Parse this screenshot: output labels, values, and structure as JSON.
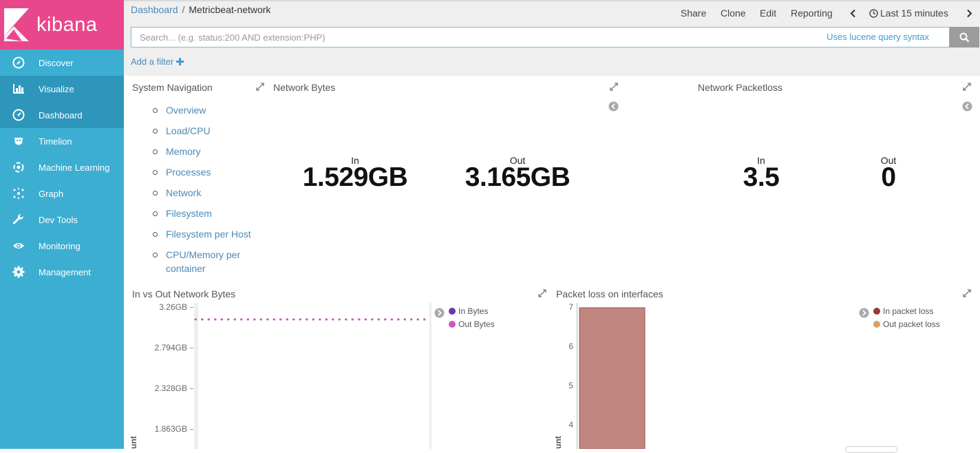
{
  "brand": {
    "name": "kibana",
    "logo_color": "#e8488b",
    "sidebar_color": "#3caed2",
    "active_color": "#2e96bb"
  },
  "sidebar": {
    "items": [
      {
        "label": "Discover",
        "icon": "compass-icon"
      },
      {
        "label": "Visualize",
        "icon": "bar-chart-icon"
      },
      {
        "label": "Dashboard",
        "icon": "dashboard-icon",
        "active": true
      },
      {
        "label": "Timelion",
        "icon": "timelion-icon"
      },
      {
        "label": "Machine Learning",
        "icon": "machine-learning-icon"
      },
      {
        "label": "Graph",
        "icon": "graph-icon"
      },
      {
        "label": "Dev Tools",
        "icon": "wrench-icon"
      },
      {
        "label": "Monitoring",
        "icon": "eye-icon"
      },
      {
        "label": "Management",
        "icon": "gear-icon"
      }
    ]
  },
  "breadcrumb": {
    "root": "Dashboard",
    "separator": "/",
    "current": "Metricbeat-network"
  },
  "menu": {
    "share": "Share",
    "clone": "Clone",
    "edit": "Edit",
    "reporting": "Reporting",
    "time": "Last 15 minutes"
  },
  "search": {
    "placeholder": "Search... (e.g. status:200 AND extension:PHP)",
    "value": "",
    "hint": "Uses lucene query syntax"
  },
  "add_filter": {
    "label": "Add a filter"
  },
  "panels": {
    "system_nav": {
      "title": "System Navigation",
      "links": [
        "Overview",
        "Load/CPU",
        "Memory",
        "Processes",
        "Network",
        "Filesystem",
        "Filesystem per Host",
        "CPU/Memory per container"
      ]
    },
    "network_bytes": {
      "title": "Network Bytes",
      "in_label": "In",
      "in_value": "1.529GB",
      "out_label": "Out",
      "out_value": "3.165GB"
    },
    "network_packetloss": {
      "title": "Network Packetloss",
      "in_label": "In",
      "in_value": "3.5",
      "out_label": "Out",
      "out_value": "0"
    },
    "in_vs_out": {
      "title": "In vs Out Network Bytes",
      "y_ticks": [
        "3.26GB",
        "2.794GB",
        "2.328GB",
        "1.863GB"
      ],
      "ylabel": "unt",
      "legend": [
        {
          "name": "In Bytes",
          "color": "#6e35a8"
        },
        {
          "name": "Out Bytes",
          "color": "#c756c7"
        }
      ]
    },
    "packet_loss": {
      "title": "Packet loss on interfaces",
      "y_ticks": [
        "7",
        "6",
        "5",
        "4"
      ],
      "ylabel": "unt",
      "legend": [
        {
          "name": "In packet loss",
          "color": "#963a34"
        },
        {
          "name": "Out packet loss",
          "color": "#d4a06e"
        }
      ]
    }
  },
  "chart_data": [
    {
      "type": "line",
      "ylabel": "unt",
      "y_tick_labels": [
        "3.26GB",
        "2.794GB",
        "2.328GB",
        "1.863GB"
      ],
      "series": [
        {
          "name": "Out Bytes",
          "color": "#c756c7",
          "style": "dotted",
          "values": [
            3.165
          ]
        },
        {
          "name": "In Bytes",
          "color": "#6e35a8",
          "values": []
        }
      ]
    },
    {
      "type": "bar",
      "ylabel": "unt",
      "y_tick_labels": [
        "7",
        "6",
        "5",
        "4"
      ],
      "series": [
        {
          "name": "In packet loss",
          "color": "#c0867f",
          "values": [
            7
          ]
        },
        {
          "name": "Out packet loss",
          "color": "#d4a06e",
          "values": []
        }
      ]
    }
  ]
}
